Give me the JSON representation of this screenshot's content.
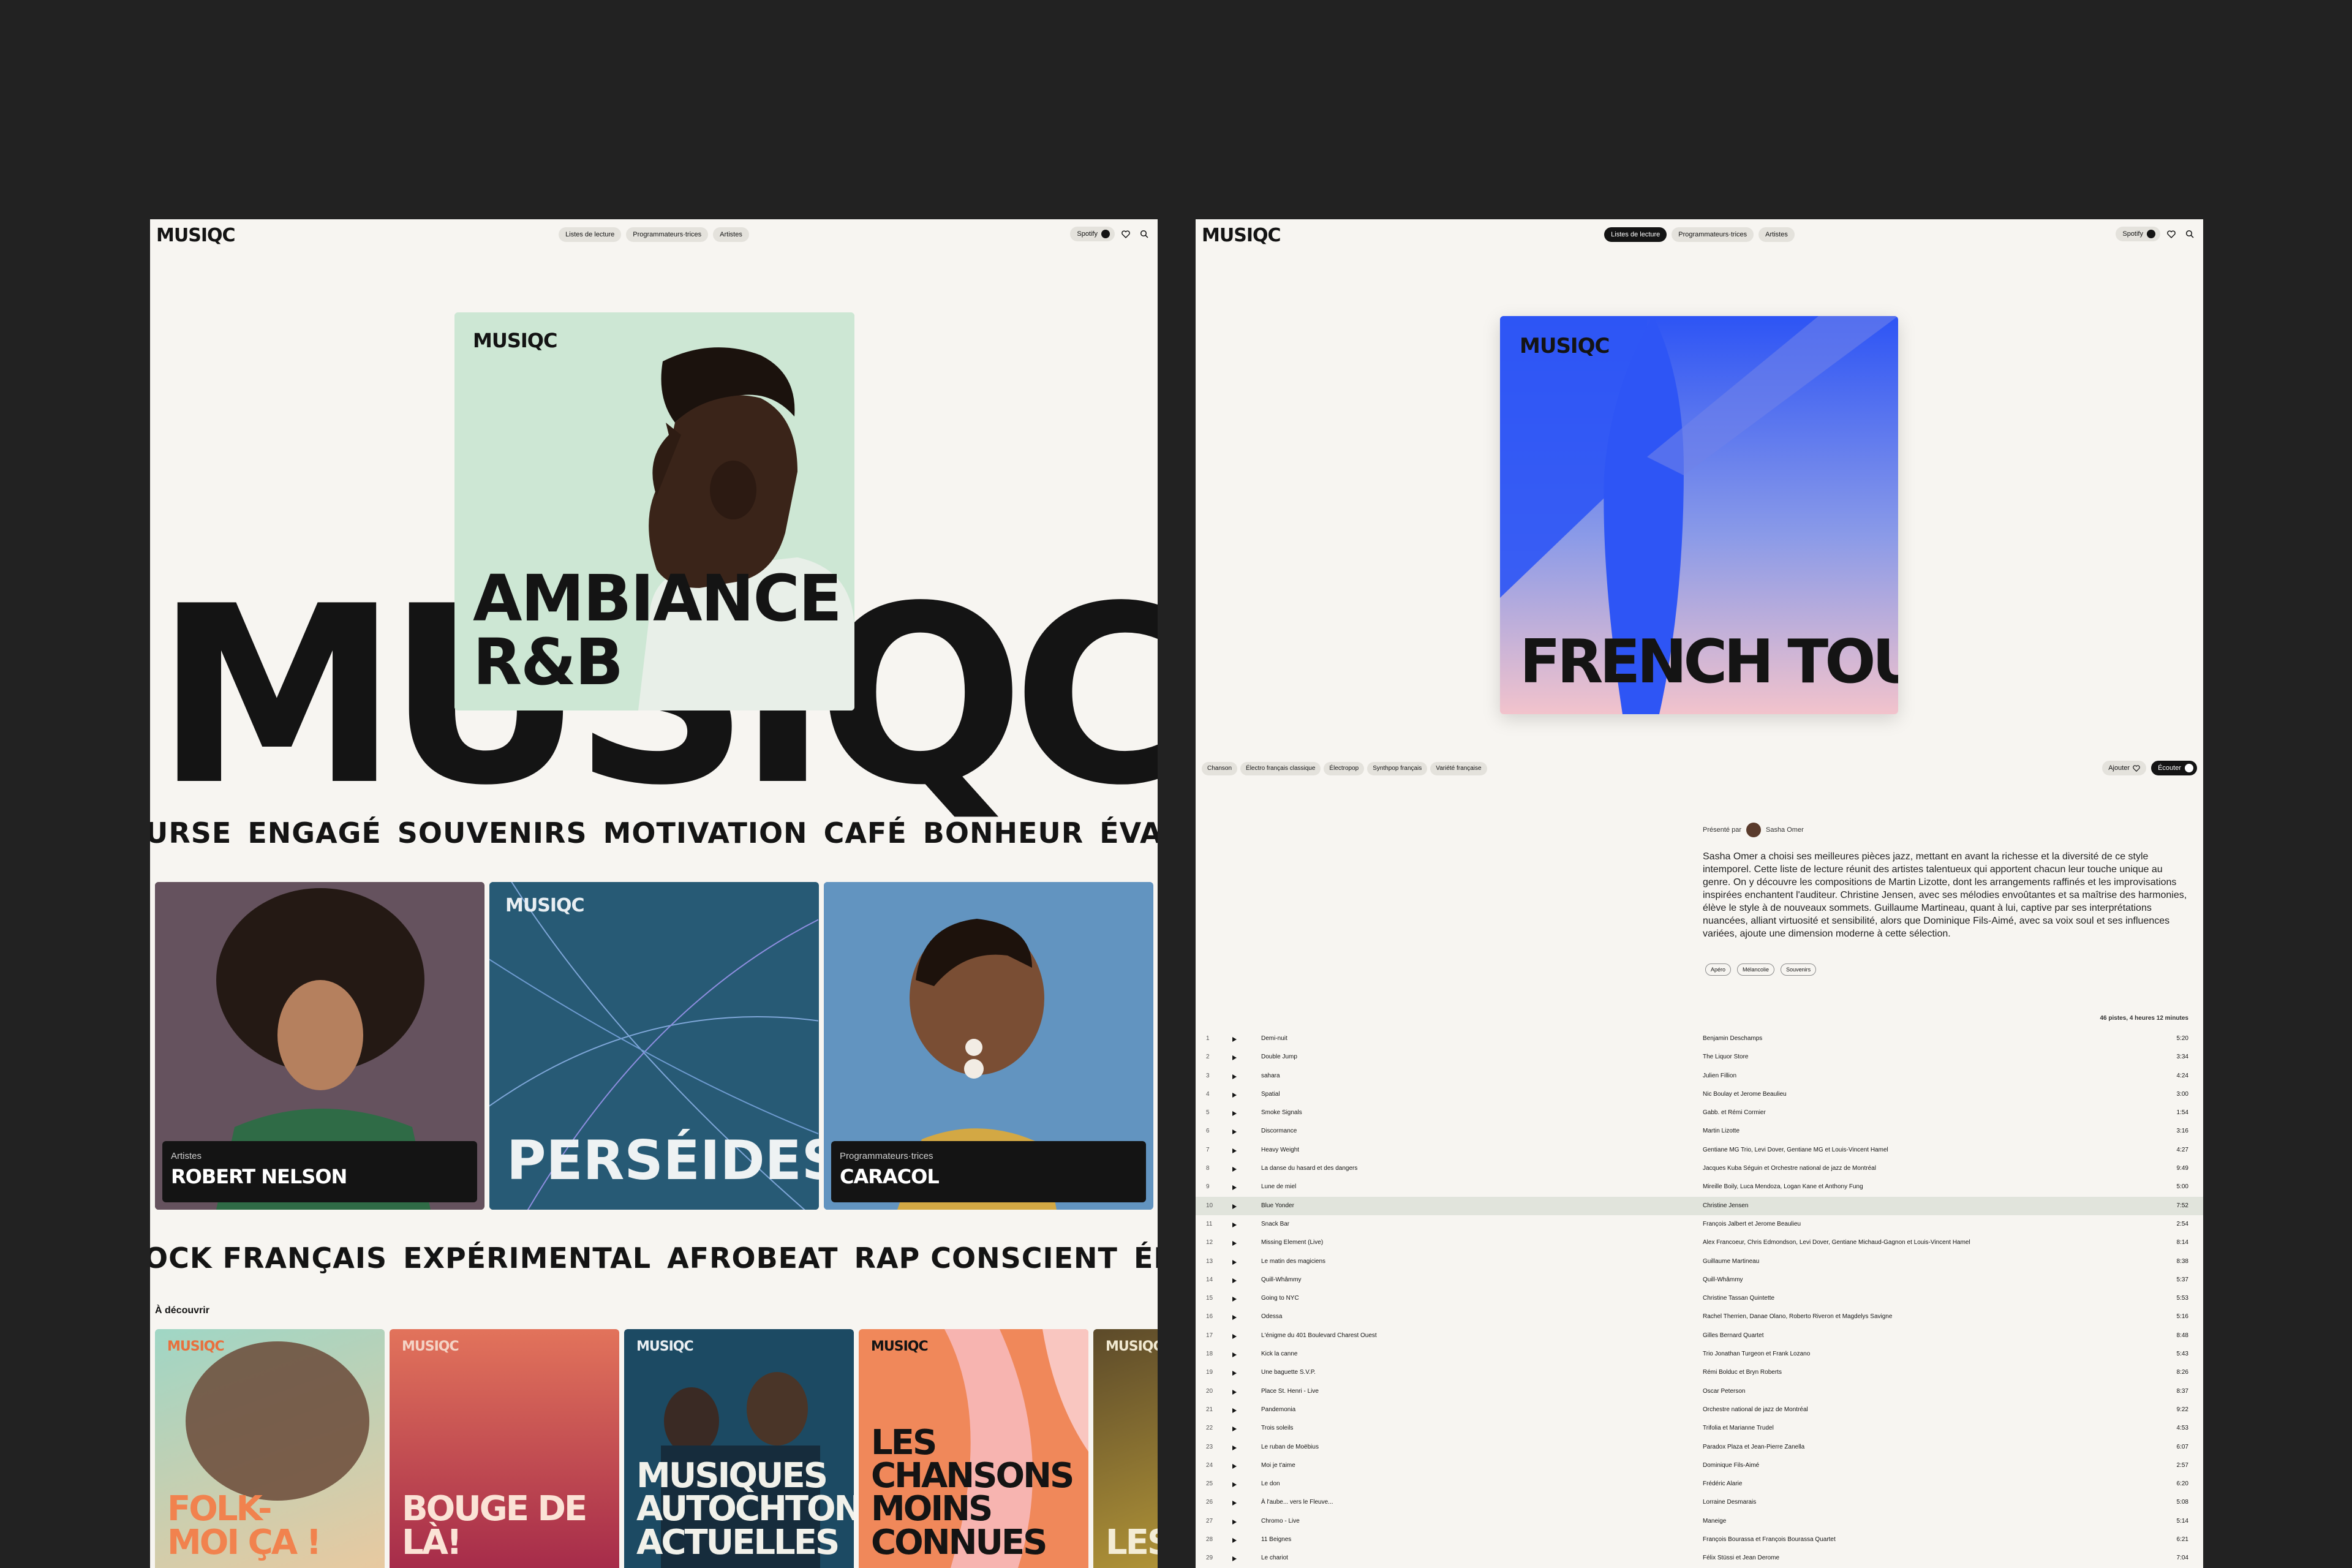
{
  "screen_a": {
    "logo": "MUSIQC",
    "nav": [
      "Listes de lecture",
      "Programmateurs·trices",
      "Artistes"
    ],
    "spotify_label": "Spotify",
    "big_logo": "MUSIQC",
    "hero": {
      "logo": "MUSIQC",
      "title_line1": "AMBIANCE",
      "title_line2": "R&B",
      "bg_color": "#cfe8d5"
    },
    "marquee_1": [
      "URSE",
      "ENGAGÉ",
      "SOUVENIRS",
      "MOTIVATION",
      "CAFÉ",
      "BONHEUR",
      "ÉVAS"
    ],
    "tiles": [
      {
        "kicker": "Artistes",
        "name": "ROBERT NELSON"
      },
      {
        "logo": "MUSIQC",
        "title": "PERSÉIDES"
      },
      {
        "kicker": "Programmateurs·trices",
        "name": "CARACOL"
      }
    ],
    "marquee_2": [
      "OCK FRANÇAIS",
      "EXPÉRIMENTAL",
      "AFROBEAT",
      "RAP CONSCIENT",
      "ÉLECT"
    ],
    "discover_heading": "À découvrir",
    "discover": [
      {
        "logo": "MUSIQC",
        "title_line1": "FOLK-",
        "title_line2": "MOI ÇA !"
      },
      {
        "logo": "MUSIQC",
        "title_line1": "BOUGE DE LÀ!",
        "title_line2": ""
      },
      {
        "logo": "MUSIQC",
        "title_line1": "MUSIQUES",
        "title_line2": "AUTOCHTONES",
        "title_line3": "ACTUELLES"
      },
      {
        "logo": "MUSIQC",
        "title_line1": "LES CHANSONS",
        "title_line2": "MOINS CONNUES"
      },
      {
        "logo": "MUSIQC",
        "title_line1": "LES"
      }
    ]
  },
  "screen_b": {
    "logo": "MUSIQC",
    "nav": [
      "Listes de lecture",
      "Programmateurs·trices",
      "Artistes"
    ],
    "nav_active": 0,
    "spotify_label": "Spotify",
    "cover": {
      "logo": "MUSIQC",
      "title": "FRENCH TOUCH !"
    },
    "genres": [
      "Chanson",
      "Électro français classique",
      "Électropop",
      "Synthpop français",
      "Variété française"
    ],
    "add_label": "Ajouter",
    "listen_label": "Écouter",
    "presented_by_label": "Présenté par",
    "curator": "Sasha Omer",
    "description": "Sasha Omer a choisi ses meilleures pièces jazz, mettant en avant la richesse et la diversité de ce style intemporel. Cette liste de lecture réunit des artistes talentueux qui apportent chacun leur touche unique au genre. On y découvre les compositions de Martin Lizotte, dont les arrangements raffinés et les improvisations inspirées enchantent l'auditeur. Christine Jensen, avec ses mélodies envoûtantes et sa maîtrise des harmonies, élève le style à de nouveaux sommets. Guillaume Martineau, quant à lui, captive par ses interprétations nuancées, alliant virtuosité et sensibilité, alors que Dominique Fils-Aimé, avec sa voix soul et ses influences variées, ajoute une dimension moderne à cette sélection.",
    "moods": [
      "Apéro",
      "Mélancolie",
      "Souvenirs"
    ],
    "summary": "46 pistes, 4 heures 12 minutes",
    "highlight_track": 10,
    "tracks": [
      {
        "n": "1",
        "title": "Demi-nuit",
        "artist": "Benjamin Deschamps",
        "dur": "5:20"
      },
      {
        "n": "2",
        "title": "Double Jump",
        "artist": "The Liquor Store",
        "dur": "3:34"
      },
      {
        "n": "3",
        "title": "sahara",
        "artist": "Julien Fillion",
        "dur": "4:24"
      },
      {
        "n": "4",
        "title": "Spatial",
        "artist": "Nic Boulay et Jerome Beaulieu",
        "dur": "3:00"
      },
      {
        "n": "5",
        "title": "Smoke Signals",
        "artist": "Gabb. et Rémi Cormier",
        "dur": "1:54"
      },
      {
        "n": "6",
        "title": "Discormance",
        "artist": "Martin Lizotte",
        "dur": "3:16"
      },
      {
        "n": "7",
        "title": "Heavy Weight",
        "artist": "Gentiane MG Trio, Levi Dover, Gentiane MG et Louis-Vincent Hamel",
        "dur": "4:27"
      },
      {
        "n": "8",
        "title": "La danse du hasard et des dangers",
        "artist": "Jacques Kuba Séguin et Orchestre national de jazz de Montréal",
        "dur": "9:49"
      },
      {
        "n": "9",
        "title": "Lune de miel",
        "artist": "Mireille Boily, Luca Mendoza, Logan Kane et Anthony Fung",
        "dur": "5:00"
      },
      {
        "n": "10",
        "title": "Blue Yonder",
        "artist": "Christine Jensen",
        "dur": "7:52"
      },
      {
        "n": "11",
        "title": "Snack Bar",
        "artist": "François Jalbert et Jerome Beaulieu",
        "dur": "2:54"
      },
      {
        "n": "12",
        "title": "Missing Element (Live)",
        "artist": "Alex Francoeur, Chris Edmondson, Levi Dover, Gentiane Michaud-Gagnon et Louis-Vincent Hamel",
        "dur": "8:14"
      },
      {
        "n": "13",
        "title": "Le matin des magiciens",
        "artist": "Guillaume Martineau",
        "dur": "8:38"
      },
      {
        "n": "14",
        "title": "Quill-Whâmmy",
        "artist": "Quill-Whâmmy",
        "dur": "5:37"
      },
      {
        "n": "15",
        "title": "Going to NYC",
        "artist": "Christine Tassan Quintette",
        "dur": "5:53"
      },
      {
        "n": "16",
        "title": "Odessa",
        "artist": "Rachel Therrien, Danae Olano, Roberto Riveron et Magdelys Savigne",
        "dur": "5:16"
      },
      {
        "n": "17",
        "title": "L'énigme du 401 Boulevard Charest Ouest",
        "artist": "Gilles Bernard Quartet",
        "dur": "8:48"
      },
      {
        "n": "18",
        "title": "Kick la canne",
        "artist": "Trio Jonathan Turgeon et Frank Lozano",
        "dur": "5:43"
      },
      {
        "n": "19",
        "title": "Une baguette S.V.P.",
        "artist": "Rémi Bolduc et Bryn Roberts",
        "dur": "8:26"
      },
      {
        "n": "20",
        "title": "Place St. Henri - Live",
        "artist": "Oscar Peterson",
        "dur": "8:37"
      },
      {
        "n": "21",
        "title": "Pandemonia",
        "artist": "Orchestre national de jazz de Montréal",
        "dur": "9:22"
      },
      {
        "n": "22",
        "title": "Trois soleils",
        "artist": "Trifolia et Marianne Trudel",
        "dur": "4:53"
      },
      {
        "n": "23",
        "title": "Le ruban de Moëbius",
        "artist": "Paradox Plaza et Jean-Pierre Zanella",
        "dur": "6:07"
      },
      {
        "n": "24",
        "title": "Moi je t'aime",
        "artist": "Dominique Fils-Aimé",
        "dur": "2:57"
      },
      {
        "n": "25",
        "title": "Le don",
        "artist": "Frédéric Alarie",
        "dur": "6:20"
      },
      {
        "n": "26",
        "title": "À l'aube... vers le Fleuve...",
        "artist": "Lorraine Desmarais",
        "dur": "5:08"
      },
      {
        "n": "27",
        "title": "Chromo - Live",
        "artist": "Maneige",
        "dur": "5:14"
      },
      {
        "n": "28",
        "title": "11 Beignes",
        "artist": "François Bourassa et François Bourassa Quartet",
        "dur": "6:21"
      },
      {
        "n": "29",
        "title": "Le chariot",
        "artist": "Félix Stüssi et Jean Derome",
        "dur": "7:04"
      }
    ]
  }
}
